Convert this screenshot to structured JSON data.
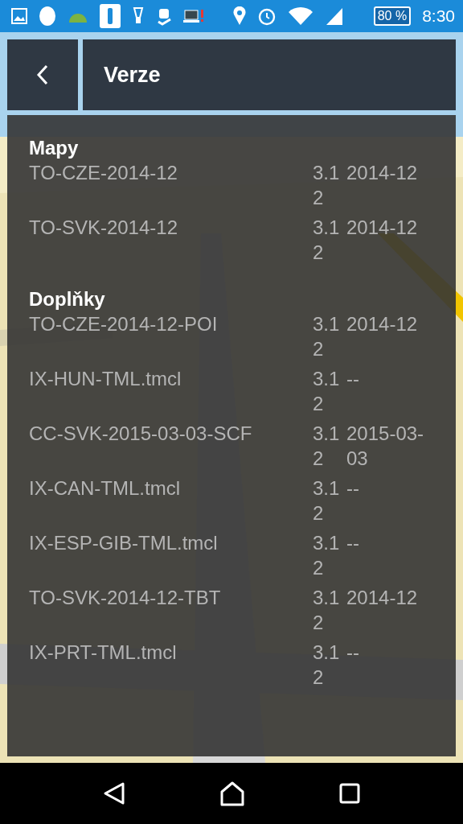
{
  "status_bar": {
    "battery": "80 %",
    "time": "8:30"
  },
  "header": {
    "title": "Verze"
  },
  "sections": [
    {
      "title": "Mapy",
      "items": [
        {
          "name": "TO-CZE-2014-12",
          "version": "3.12",
          "date": "2014-12"
        },
        {
          "name": "TO-SVK-2014-12",
          "version": "3.12",
          "date": "2014-12"
        }
      ]
    },
    {
      "title": "Doplňky",
      "items": [
        {
          "name": "TO-CZE-2014-12-POI",
          "version": "3.12",
          "date": "2014-12"
        },
        {
          "name": "IX-HUN-TML.tmcl",
          "version": "3.12",
          "date": "--"
        },
        {
          "name": "CC-SVK-2015-03-03-SCF",
          "version": "3.12",
          "date": "2015-03-03"
        },
        {
          "name": "IX-CAN-TML.tmcl",
          "version": "3.12",
          "date": "--"
        },
        {
          "name": "IX-ESP-GIB-TML.tmcl",
          "version": "3.12",
          "date": "--"
        },
        {
          "name": "TO-SVK-2014-12-TBT",
          "version": "3.12",
          "date": "2014-12"
        },
        {
          "name": "IX-PRT-TML.tmcl",
          "version": "3.12",
          "date": "--"
        }
      ]
    }
  ]
}
